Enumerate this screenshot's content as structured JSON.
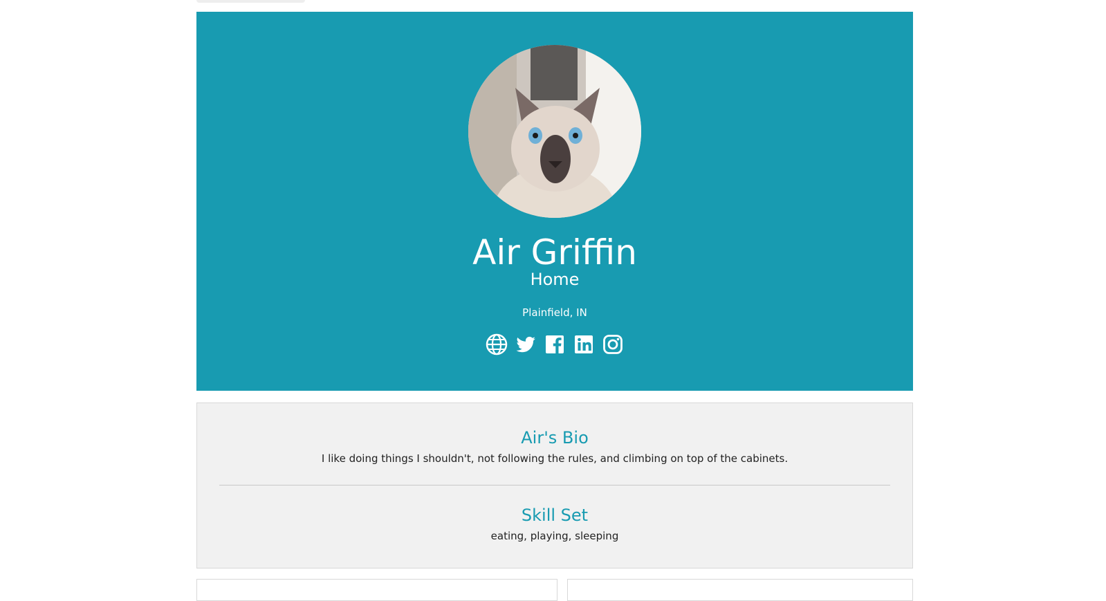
{
  "profile": {
    "name": "Air Griffin",
    "role": "Home",
    "location": "Plainfield, IN",
    "avatar": "cat-photo"
  },
  "socials": [
    {
      "icon": "globe-icon"
    },
    {
      "icon": "twitter-icon"
    },
    {
      "icon": "facebook-icon"
    },
    {
      "icon": "linkedin-icon"
    },
    {
      "icon": "instagram-icon"
    }
  ],
  "bio": {
    "title": "Air's Bio",
    "text": "I like doing things I shouldn't, not following the rules, and climbing on top of the cabinets."
  },
  "skills": {
    "title": "Skill Set",
    "text": "eating, playing, sleeping"
  },
  "colors": {
    "accent": "#189bb1",
    "card_background": "#f1f1f1",
    "text": "#222222"
  }
}
